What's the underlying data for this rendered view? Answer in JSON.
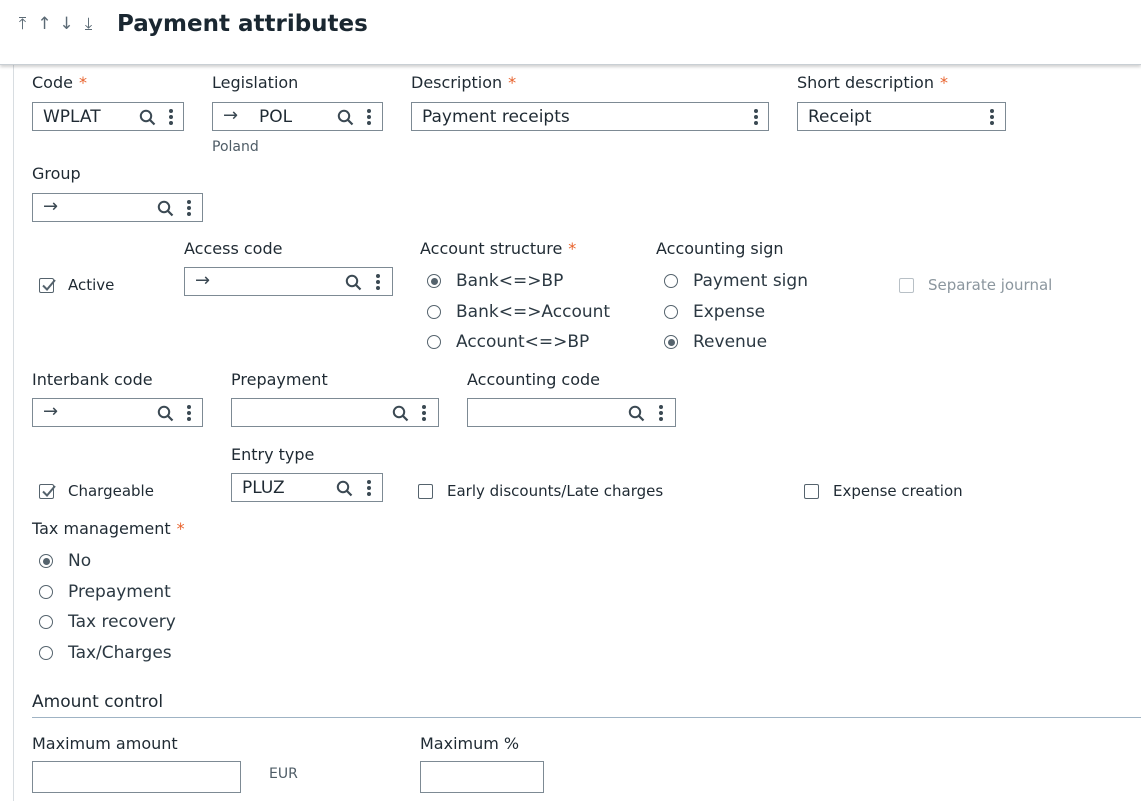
{
  "header": {
    "title": "Payment attributes",
    "nav": [
      {
        "name": "nav-first-icon",
        "glyph": "⤒"
      },
      {
        "name": "nav-prev-icon",
        "glyph": "↑"
      },
      {
        "name": "nav-next-icon",
        "glyph": "↓"
      },
      {
        "name": "nav-last-icon",
        "glyph": "⤓"
      }
    ]
  },
  "fields": {
    "code": {
      "label": "Code",
      "required": "*",
      "value": "WPLAT"
    },
    "legislation": {
      "label": "Legislation",
      "arrow": "→",
      "value": "POL",
      "sub": "Poland"
    },
    "description": {
      "label": "Description",
      "required": "*",
      "value": "Payment receipts"
    },
    "short_description": {
      "label": "Short description",
      "required": "*",
      "value": "Receipt"
    },
    "group": {
      "label": "Group",
      "arrow": "→",
      "value": ""
    },
    "access_code": {
      "label": "Access code",
      "arrow": "→",
      "value": ""
    },
    "interbank_code": {
      "label": "Interbank code",
      "arrow": "→",
      "value": ""
    },
    "prepayment": {
      "label": "Prepayment",
      "value": ""
    },
    "accounting_code": {
      "label": "Accounting code",
      "value": ""
    },
    "entry_type": {
      "label": "Entry type",
      "value": "PLUZ"
    },
    "maximum_amount": {
      "label": "Maximum amount",
      "value": "",
      "unit": "EUR"
    },
    "maximum_percent": {
      "label": "Maximum %",
      "value": ""
    }
  },
  "checkboxes": {
    "active": {
      "label": "Active",
      "checked": true
    },
    "separate_journal": {
      "label": "Separate journal",
      "checked": false,
      "disabled": true
    },
    "chargeable": {
      "label": "Chargeable",
      "checked": true
    },
    "early_discounts": {
      "label": "Early discounts/Late charges",
      "checked": false
    },
    "expense_creation": {
      "label": "Expense creation",
      "checked": false
    }
  },
  "account_structure": {
    "label": "Account structure",
    "required": "*",
    "options": [
      {
        "label": "Bank<=>BP",
        "selected": true
      },
      {
        "label": "Bank<=>Account",
        "selected": false
      },
      {
        "label": "Account<=>BP",
        "selected": false
      }
    ]
  },
  "accounting_sign": {
    "label": "Accounting sign",
    "options": [
      {
        "label": "Payment sign",
        "selected": false
      },
      {
        "label": "Expense",
        "selected": false
      },
      {
        "label": "Revenue",
        "selected": true
      }
    ]
  },
  "tax_management": {
    "label": "Tax management",
    "required": "*",
    "options": [
      {
        "label": "No",
        "selected": true
      },
      {
        "label": "Prepayment",
        "selected": false
      },
      {
        "label": "Tax recovery",
        "selected": false
      },
      {
        "label": "Tax/Charges",
        "selected": false
      }
    ]
  },
  "amount_control": {
    "title": "Amount control"
  }
}
